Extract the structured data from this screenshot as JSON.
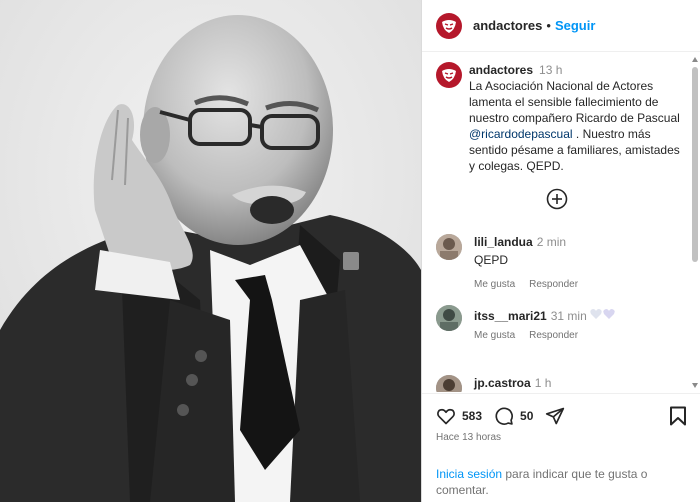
{
  "post": {
    "username": "andactores",
    "separator": "•",
    "follow_label": "Seguir"
  },
  "caption": {
    "username": "andactores",
    "time": "13 h",
    "text_before": "La Asociación Nacional de Actores lamenta el sensible fallecimiento de nuestro compañero Ricardo de Pascual ",
    "mention": "@ricardodepascual",
    "text_after": " . Nuestro más sentido pésame a familiares, amistades y colegas.  QEPD."
  },
  "comments": [
    {
      "username": "lili_landua",
      "time": "2 min",
      "text": "QEPD",
      "like_label": "Me gusta",
      "reply_label": "Responder"
    },
    {
      "username": "itss__mari21",
      "time": "31 min",
      "text": "",
      "like_label": "Me gusta",
      "reply_label": "Responder"
    },
    {
      "username": "jp.castroa",
      "time": "1 h",
      "text": ""
    }
  ],
  "actions": {
    "likes": "583",
    "comments": "50",
    "posted": "Hace 13 horas"
  },
  "login_prompt": {
    "link": "Inicia sesión",
    "text": " para indicar que te gusta o comentar."
  },
  "colors": {
    "brand": "#b5182b",
    "link": "#0095f6",
    "mention": "#00376b"
  },
  "icons": [
    "andactores-logo-icon",
    "plus-circle-icon",
    "heart-icon",
    "comment-icon",
    "share-icon",
    "bookmark-icon"
  ]
}
